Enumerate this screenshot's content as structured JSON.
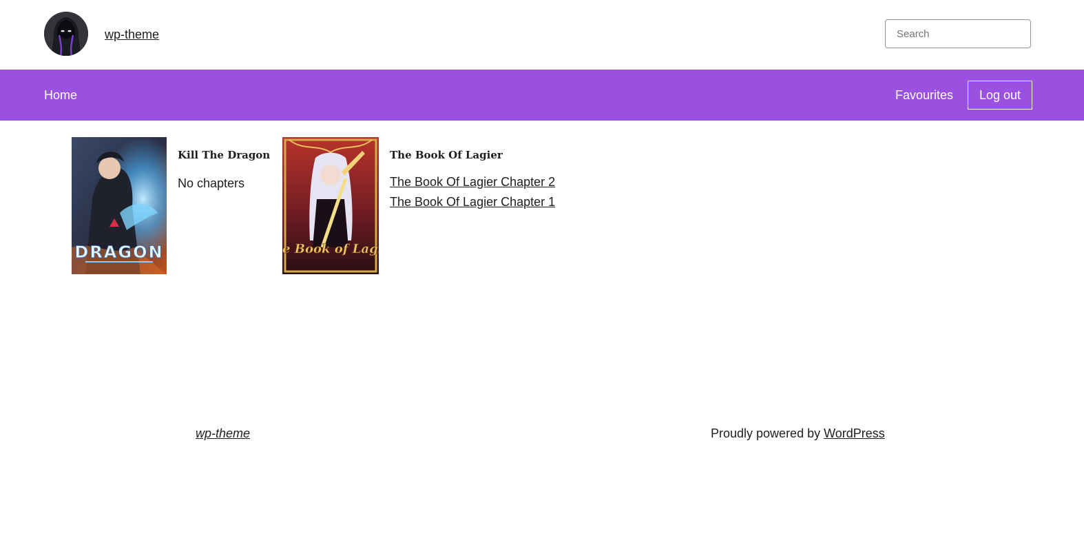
{
  "colors": {
    "nav_background": "#9b51e0",
    "nav_text": "#ffffff",
    "text": "#1e1e1e"
  },
  "header": {
    "site_title": "wp-theme",
    "logo_icon": "hooded-figure-avatar",
    "search": {
      "placeholder": "Search",
      "value": ""
    }
  },
  "nav": {
    "home_label": "Home",
    "favourites_label": "Favourites",
    "logout_label": "Log out"
  },
  "favourites": [
    {
      "title": "Kill The Dragon",
      "cover_text": "DRAGON",
      "chapters": [],
      "empty_text": "No chapters"
    },
    {
      "title": "The Book Of Lagier",
      "cover_text": "The Book of Lagier",
      "chapters": [
        "The Book Of Lagier Chapter 2",
        "The Book Of Lagier Chapter 1"
      ],
      "empty_text": ""
    }
  ],
  "footer": {
    "site_title": "wp-theme",
    "credit_prefix": "Proudly powered by ",
    "credit_link": "WordPress"
  }
}
